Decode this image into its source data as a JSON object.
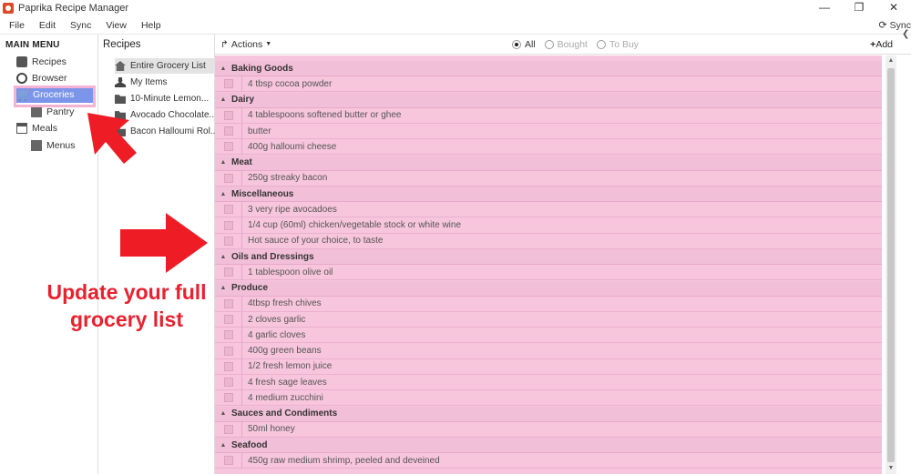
{
  "window": {
    "title": "Paprika Recipe Manager",
    "controls": [
      "—",
      "❐",
      "✕"
    ]
  },
  "menubar": {
    "items": [
      "File",
      "Edit",
      "Sync",
      "View",
      "Help"
    ],
    "sync_label": "Sync"
  },
  "left_menu": {
    "heading": "MAIN MENU",
    "items": [
      {
        "label": "Recipes",
        "icon": "recipes-icon"
      },
      {
        "label": "Browser",
        "icon": "browser-icon"
      },
      {
        "label": "Groceries",
        "icon": "cart-icon",
        "active": true
      },
      {
        "label": "Pantry",
        "icon": "pantry-icon"
      },
      {
        "label": "Meals",
        "icon": "meals-icon"
      },
      {
        "label": "Menus",
        "icon": "menus-icon"
      }
    ]
  },
  "recipes_panel": {
    "heading": "Recipes",
    "items": [
      {
        "label": "Entire Grocery List",
        "icon": "home-icon"
      },
      {
        "label": "My Items",
        "icon": "person-icon"
      },
      {
        "label": "10-Minute Lemon...",
        "icon": "folder-icon"
      },
      {
        "label": "Avocado Chocolate...",
        "icon": "folder-icon"
      },
      {
        "label": "Bacon Halloumi Rol...",
        "icon": "folder-icon"
      }
    ]
  },
  "toolbar": {
    "actions_label": "Actions",
    "filters": [
      {
        "label": "All",
        "checked": true
      },
      {
        "label": "Bought",
        "checked": false
      },
      {
        "label": "To Buy",
        "checked": false
      }
    ],
    "add_label": "Add"
  },
  "grocery": {
    "categories": [
      {
        "name": "Baking Goods",
        "items": [
          "4 tbsp cocoa powder"
        ]
      },
      {
        "name": "Dairy",
        "items": [
          "4 tablespoons softened butter or ghee",
          "butter",
          "400g halloumi cheese"
        ]
      },
      {
        "name": "Meat",
        "items": [
          "250g streaky bacon"
        ]
      },
      {
        "name": "Miscellaneous",
        "items": [
          "3 very ripe avocadoes",
          "1/4 cup (60ml) chicken/vegetable stock or white wine",
          "Hot sauce of your choice, to taste"
        ]
      },
      {
        "name": "Oils and Dressings",
        "items": [
          "1 tablespoon olive oil"
        ]
      },
      {
        "name": "Produce",
        "items": [
          "4tbsp fresh chives",
          "2 cloves garlic",
          "4 garlic cloves",
          "400g green beans",
          "1/2 fresh lemon juice",
          "4 fresh sage leaves",
          "4 medium zucchini"
        ]
      },
      {
        "name": "Sauces and Condiments",
        "items": [
          "50ml honey"
        ]
      },
      {
        "name": "Seafood",
        "items": [
          "450g raw medium shrimp, peeled and deveined"
        ]
      }
    ]
  },
  "annotation": {
    "line1": "Update your full",
    "line2": "grocery list",
    "color": "#e8212f"
  },
  "colors": {
    "list_bg": "#f7c5dc",
    "active_nav": "#7b95e8",
    "highlight_box": "#f5b2d4"
  }
}
